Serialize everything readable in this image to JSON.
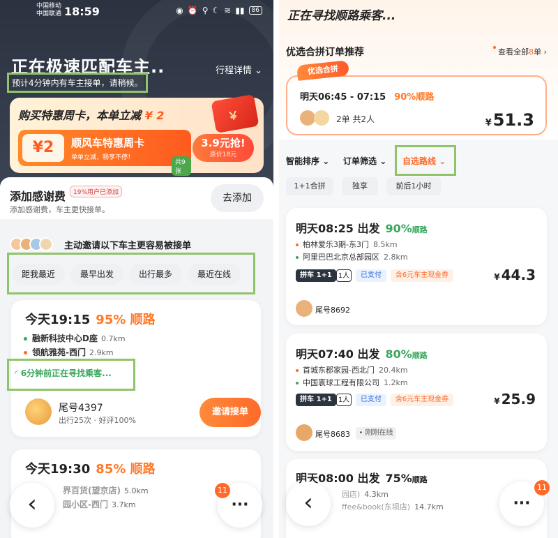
{
  "left": {
    "status": {
      "carrier1": "中国移动",
      "carrier2": "中国联通",
      "time": "18:59",
      "battery": "86"
    },
    "match_title": "正在极速匹配车主..",
    "trip_detail": "行程详情",
    "estimate": "预计4分钟内有车主接单，请稍候。",
    "promo": {
      "headline_prefix": "购买特惠周卡，本单立减 ",
      "headline_amount": "¥ 2",
      "coupon_amount": "¥2",
      "card_name": "顺风车特惠周卡",
      "card_sub": "单单立减，畅享不停！",
      "count": "共9张",
      "buy_price": "3.9元抢!",
      "original_price": "原价18元"
    },
    "thanks": {
      "title": "添加感谢费",
      "badge": "19%用户已添加",
      "sub": "添加感谢费，车主更快接单。",
      "button": "去添加"
    },
    "invite_text": "主动邀请以下车主更容易被接单",
    "filters": [
      "距我最近",
      "最早出发",
      "出行最多",
      "最近在线"
    ],
    "card1": {
      "time": "今天19:15",
      "pct": "95% 顺路",
      "stops": [
        {
          "name": "融新科技中心D座",
          "dist": "0.7km"
        },
        {
          "name": "领航雅苑-西门",
          "dist": "2.9km"
        }
      ],
      "seek": "6分钟前正在寻找乘客...",
      "driver": "尾号4397",
      "meta": "出行25次 · 好评100%",
      "button": "邀请接单"
    },
    "card2": {
      "time": "今天19:30",
      "pct": "85% 顺路",
      "stops": [
        {
          "name": "界百货(望京店)",
          "dist": "5.0km"
        },
        {
          "name": "园小区-西门",
          "dist": "3.7km"
        }
      ]
    },
    "badge": "11",
    "back": "‹",
    "more": "···"
  },
  "right": {
    "title": "正在寻找顺路乘客...",
    "section": "优选合拼订单推荐",
    "view_all": "查看全部",
    "view_all_num": "8",
    "view_all_unit": "单",
    "pool": {
      "tag": "优选合拼",
      "time": "明天06:45 - 07:15",
      "pct": "90%顺路",
      "info": "2单 共2人",
      "price": "51.3",
      "currency": "¥"
    },
    "sort": [
      "智能排序",
      "订单筛选",
      "自选路线"
    ],
    "tags": [
      "1+1合拼",
      "独享",
      "前后1小时"
    ],
    "orders": [
      {
        "time": "明天08:25 出发",
        "pct": "90%",
        "pct_label": "顺路",
        "stops": [
          {
            "name": "柏林爱乐3期-东3门",
            "dist": "8.5km"
          },
          {
            "name": "阿里巴巴北京总部园区",
            "dist": "2.8km"
          }
        ],
        "pill_type": "拼车 1+1",
        "pill_people": "1人",
        "paid": "已支付",
        "coupon": "含6元车主现金券",
        "price": "44.3",
        "driver": "尾号8692",
        "online": ""
      },
      {
        "time": "明天07:40 出发",
        "pct": "80%",
        "pct_label": "顺路",
        "stops": [
          {
            "name": "首城东郡家园-西北门",
            "dist": "20.4km"
          },
          {
            "name": "中国寰球工程有限公司",
            "dist": "1.2km"
          }
        ],
        "pill_type": "拼车 1+1",
        "pill_people": "1人",
        "paid": "已支付",
        "coupon": "含6元车主现金券",
        "price": "25.9",
        "driver": "尾号8683",
        "online": "• 刚刚在线"
      },
      {
        "time": "明天08:00 出发",
        "pct": "75%",
        "pct_label": "顺路",
        "stops": [
          {
            "name": "园店)",
            "dist": "4.3km"
          },
          {
            "name": "ffee&book(东坝店)",
            "dist": "14.7km"
          }
        ]
      }
    ],
    "badge": "11",
    "back": "‹",
    "more": "···"
  },
  "colors": {
    "accent": "#ff6a2a",
    "green": "#3aa65c",
    "highlight_box": "#8fc46a",
    "dark_header": "#2b3240"
  }
}
